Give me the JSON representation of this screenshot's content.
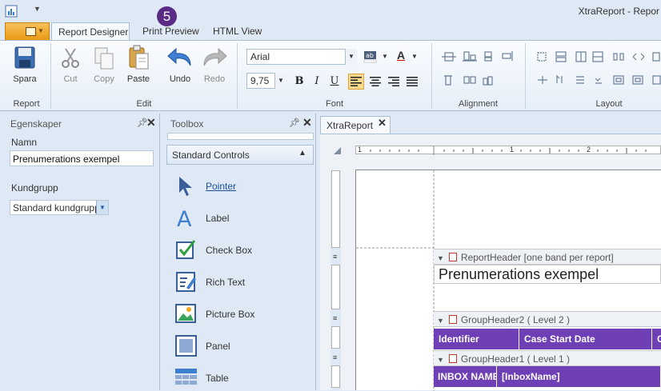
{
  "window": {
    "title": "XtraReport - Repor",
    "badge": "5"
  },
  "tabs": [
    {
      "label": "Report Designer"
    },
    {
      "label": "Print Preview"
    },
    {
      "label": "HTML View"
    }
  ],
  "ribbon": {
    "report": {
      "label": "Report",
      "save": "Spara"
    },
    "edit": {
      "label": "Edit",
      "cut": "Cut",
      "copy": "Copy",
      "paste": "Paste",
      "undo": "Undo",
      "redo": "Redo"
    },
    "font": {
      "label": "Font",
      "name": "Arial",
      "size": "9,75",
      "bold": "B",
      "italic": "I",
      "underline": "U",
      "font_color_glyph": "A"
    },
    "alignment": {
      "label": "Alignment"
    },
    "layout": {
      "label": "Layout"
    }
  },
  "properties": {
    "title": "Egenskaper",
    "namn_label": "Namn",
    "namn_value": "Prenumerations exempel",
    "kundgrupp_label": "Kundgrupp",
    "kundgrupp_value": "Standard kundgrupp"
  },
  "toolbox": {
    "title": "Toolbox",
    "section": "Standard Controls",
    "items": [
      {
        "label": "Pointer",
        "icon": "pointer-icon"
      },
      {
        "label": "Label",
        "icon": "label-icon"
      },
      {
        "label": "Check Box",
        "icon": "checkbox-icon"
      },
      {
        "label": "Rich Text",
        "icon": "rich-text-icon"
      },
      {
        "label": "Picture Box",
        "icon": "picture-box-icon"
      },
      {
        "label": "Panel",
        "icon": "panel-icon"
      },
      {
        "label": "Table",
        "icon": "table-icon"
      }
    ]
  },
  "designer": {
    "doc_tab": "XtraReport",
    "ruler_marks": [
      "1",
      "1",
      "2"
    ],
    "bands": {
      "report_header": "ReportHeader [one band per report]",
      "group_header2": "GroupHeader2 ( Level 2 )",
      "group_header1": "GroupHeader1 ( Level 1 )"
    },
    "report_title": "Prenumerations exempel",
    "header_row": [
      "Identifier",
      "Case Start Date",
      "C"
    ],
    "inbox_row": [
      "INBOX NAME",
      "[InboxName]"
    ]
  },
  "colors": {
    "accent_purple": "#6f3fb5",
    "badge_purple": "#5b2a86",
    "file_tab_orange": "#f0a020",
    "ribbon_bg": "#dfe9f5"
  }
}
